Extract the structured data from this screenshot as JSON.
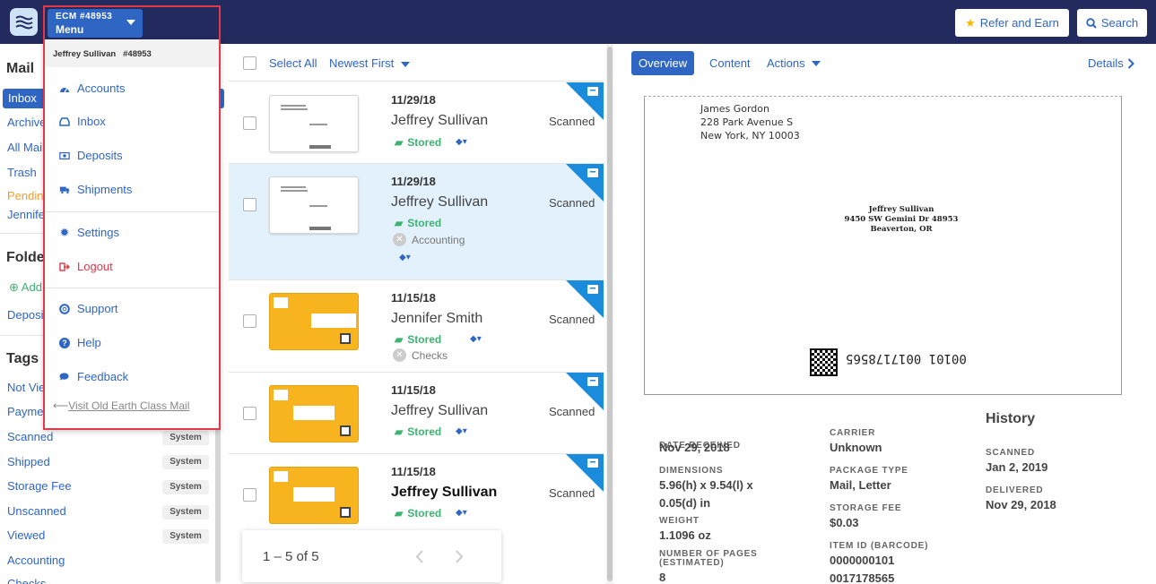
{
  "topbar": {
    "account_code": "ECM #48953",
    "menu_label": "Menu",
    "refer_label": "Refer and Earn",
    "search_label": "Search"
  },
  "dropdown": {
    "user": "Jeffrey Sullivan   #48953",
    "items": [
      {
        "label": "Accounts",
        "icon": "dashboard-icon"
      },
      {
        "label": "Inbox",
        "icon": "inbox-icon"
      },
      {
        "label": "Deposits",
        "icon": "money-icon"
      },
      {
        "label": "Shipments",
        "icon": "truck-icon"
      },
      {
        "label": "Settings",
        "icon": "gear-icon"
      },
      {
        "label": "Logout",
        "icon": "logout-icon"
      },
      {
        "label": "Support",
        "icon": "lifebuoy-icon"
      },
      {
        "label": "Help",
        "icon": "question-icon"
      },
      {
        "label": "Feedback",
        "icon": "chat-icon"
      }
    ],
    "old_link": "Visit Old Earth Class Mail"
  },
  "sidebar": {
    "mail_heading": "Mail",
    "mail_items": [
      "Inbox",
      "Archive",
      "All Mail",
      "Trash",
      "Pending",
      "Jennifer"
    ],
    "folders_heading": "Folders",
    "add_label": "Add",
    "deposit_label": "Deposit",
    "tags_heading": "Tags",
    "tags": [
      {
        "label": "Not Viewed",
        "badge": ""
      },
      {
        "label": "Payment",
        "badge": ""
      },
      {
        "label": "Scanned",
        "badge": "System"
      },
      {
        "label": "Shipped",
        "badge": "System"
      },
      {
        "label": "Storage Fee",
        "badge": "System"
      },
      {
        "label": "Unscanned",
        "badge": "System"
      },
      {
        "label": "Viewed",
        "badge": "System"
      },
      {
        "label": "Accounting",
        "badge": ""
      },
      {
        "label": "Checks",
        "badge": ""
      }
    ]
  },
  "list": {
    "select_all": "Select All",
    "sort": "Newest First",
    "rows": [
      {
        "date": "11/29/18",
        "name": "Jeffrey Sullivan",
        "status": "Scanned",
        "stored": "Stored",
        "category": "",
        "selected": false,
        "bold": false
      },
      {
        "date": "11/29/18",
        "name": "Jeffrey Sullivan",
        "status": "Scanned",
        "stored": "Stored",
        "category": "Accounting",
        "selected": true,
        "bold": false
      },
      {
        "date": "11/15/18",
        "name": "Jennifer Smith",
        "status": "Scanned",
        "stored": "Stored",
        "category": "Checks",
        "selected": false,
        "bold": false
      },
      {
        "date": "11/15/18",
        "name": "Jeffrey Sullivan",
        "status": "Scanned",
        "stored": "Stored",
        "category": "",
        "selected": false,
        "bold": false
      },
      {
        "date": "11/15/18",
        "name": "Jeffrey Sullivan",
        "status": "Scanned",
        "stored": "Stored",
        "category": "",
        "selected": false,
        "bold": true
      }
    ],
    "pager": "1 – 5 of 5"
  },
  "detail": {
    "tabs": [
      "Overview",
      "Content",
      "Actions"
    ],
    "details_link": "Details",
    "envelope": {
      "from": [
        "James Gordon",
        "228 Park Avenue S",
        "New York, NY 10003"
      ],
      "to": [
        "Jeffrey Sullivan",
        "9450 SW Gemini Dr 48953",
        "Beaverton, OR"
      ],
      "barcode": "00101 0017178565"
    },
    "fields": {
      "date_received_label": "DATE RECEIVED",
      "date_received": "Nov 29, 2018",
      "carrier_label": "CARRIER",
      "carrier": "Unknown",
      "dimensions_label": "DIMENSIONS",
      "dimensions_1": "5.96(h) x 9.54(l) x",
      "dimensions_2": "0.05(d) in",
      "package_label": "PACKAGE TYPE",
      "package": "Mail, Letter",
      "weight_label": "WEIGHT",
      "weight": "1.1096 oz",
      "storage_label": "STORAGE FEE",
      "storage": "$0.03",
      "pages_label_1": "NUMBER OF PAGES",
      "pages_label_2": "(ESTIMATED)",
      "pages": "8",
      "item_label": "ITEM ID (BARCODE)",
      "item_1": "0000000101",
      "item_2": "0017178565"
    },
    "history": {
      "title": "History",
      "scanned_label": "SCANNED",
      "scanned": "Jan 2, 2019",
      "delivered_label": "DELIVERED",
      "delivered": "Nov 29, 2018"
    }
  },
  "colors": {
    "navy": "#232a5e",
    "blue": "#2f66c4",
    "green": "#3cb371",
    "red": "#e0394a",
    "orange": "#f0a030"
  }
}
